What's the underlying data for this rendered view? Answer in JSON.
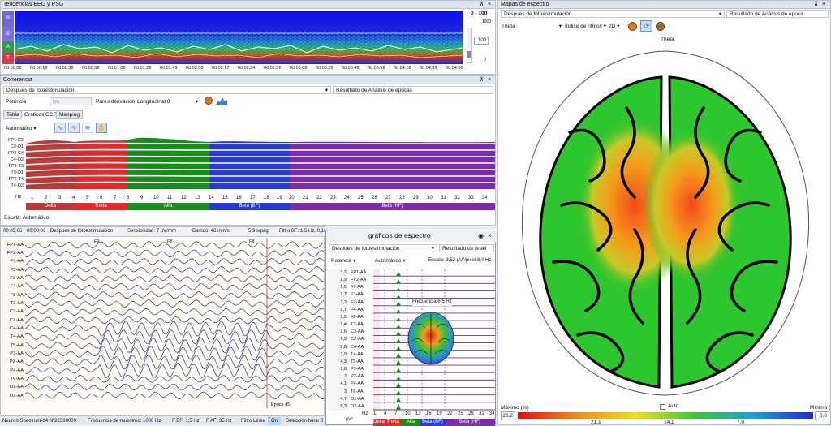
{
  "trends": {
    "title": "Tendencias EEG y PSG",
    "range": "0 - 100",
    "row_labels": [
      "B",
      "B",
      "A",
      "T"
    ],
    "scale_top": "1000",
    "scale_box": "100",
    "scale_bottom": "0",
    "times": [
      "00:00:01",
      "00:00:18",
      "00:00:35",
      "00:00:52",
      "00:01:09",
      "00:01:26",
      "00:01:43",
      "00:02:00",
      "00:02:17",
      "00:02:34",
      "00:02:51",
      "00:03:08",
      "00:03:25",
      "00:03:42",
      "00:03:59",
      "00:04:16",
      "00:04:33",
      "00:04:50"
    ]
  },
  "coherence": {
    "title": "Coherencia",
    "condition": "Despues de fotoestimulación",
    "result_label": "Resultado de Análisis de epocas",
    "mode_label": "Potencia",
    "mode_value": "No",
    "derivation_label": "Pares derivación:",
    "derivation_value": "Longitudinal 8",
    "tabs": [
      "Tabla",
      "Gráficos CCF",
      "Mapping"
    ],
    "auto": "Automático",
    "channels": [
      "FP1-C3",
      "C3-O1",
      "FP2-C4",
      "C4-O2",
      "FP1-T3",
      "T3-O1",
      "FP2-T4",
      "T4-O2"
    ],
    "hz_label": "Hz",
    "hz_ticks": [
      "1",
      "2",
      "3",
      "4",
      "5",
      "6",
      "7",
      "8",
      "9",
      "10",
      "11",
      "12",
      "13",
      "14",
      "15",
      "16",
      "17",
      "18",
      "19",
      "20",
      "21",
      "22",
      "23",
      "24",
      "25",
      "26",
      "27",
      "28",
      "29",
      "30",
      "31",
      "32",
      "33",
      "34"
    ],
    "bands": [
      "Delta",
      "Theta",
      "Alfa",
      "Beta (BF)",
      "Beta (HF)"
    ],
    "scale_note": "Escala: Automático"
  },
  "eeg": {
    "time_start": "00:05:06",
    "time_cursor": "00:00:06",
    "condition": "Despues de fotoestimulación",
    "sensitivity": "Sensibilidad: 7 µV/mm",
    "sweep": "Barrido: 48 mm/s",
    "sweep2": "5,9 s/pag",
    "hf": "Filtro BF: 1,5 Hz, 0,106",
    "marks": [
      "F9",
      "F8",
      "F8",
      "F8"
    ],
    "channels": [
      "FP1-AA",
      "FP2-AA",
      "F7-AA",
      "F3-AA",
      "FZ-AA",
      "F4-AA",
      "F8-AA",
      "T3-AA",
      "C3-AA",
      "CZ-AA",
      "C4-AA",
      "T4-AA",
      "T5-AA",
      "P3-AA",
      "PZ-AA",
      "P4-AA",
      "T6-AA",
      "O1-AA",
      "O2-AA"
    ],
    "epoch_label": "Epoca 45"
  },
  "spectrum_popup": {
    "title": "gráficos de espectro",
    "condition": "Despues de fotoestimulación",
    "result": "Resultado de Análi",
    "mode": "Potencia",
    "auto": "Automático",
    "scale": "Escala: 3,52 µV²/pixel 8,4 Hz",
    "values": [
      "3,2",
      "2,9",
      "1,5",
      "1,7",
      "3,3",
      "2,7",
      "1,5",
      "1,4",
      "2,6",
      "3,3",
      "2,8",
      "3,9",
      "4,3",
      "3,8",
      "2",
      "4,1",
      "3",
      "4,7",
      "5,3",
      "4,4"
    ],
    "channels": [
      "FP1-AA",
      "FP2-AA",
      "F7-AA",
      "F3-AA",
      "FZ-AA",
      "F4-AA",
      "F8-AA",
      "T3-AA",
      "C3-AA",
      "CZ-AA",
      "C4-AA",
      "T4-AA",
      "T5-AA",
      "P3-AA",
      "PZ-AA",
      "P4-AA",
      "T6-AA",
      "O1-AA",
      "O2-AA"
    ],
    "freq_label": "Frecuencia 6,5 Hz",
    "unit": "µV²",
    "hz": "Hz",
    "ticks": [
      "1",
      "4",
      "7",
      "10",
      "13",
      "16",
      "19",
      "22",
      "25",
      "28",
      "31",
      "34"
    ],
    "bands": [
      "Delta",
      "Theta",
      "Alfa",
      "Beta (BF)",
      "Beta (HF)"
    ]
  },
  "spectrum_map": {
    "title": "Mapas de espectro",
    "condition": "Despues de fotoestimulación",
    "result": "Resultado de Análisis de epoca",
    "rhythm": "Theta",
    "index": "Índice de ritmos",
    "view": "2D",
    "map_title": "Theta",
    "max_label": "Máximo (%)",
    "auto": "Auto",
    "min_label": "Mínimo (",
    "max_value": "28,2",
    "min_value": "0,0",
    "scale_ticks": [
      "21,1",
      "14,1",
      "7,0"
    ]
  },
  "status": {
    "device": "Neuron-Spectrum-64 Nº22360009",
    "sampling": "Frecuencia de muestreo: 1000 Hz",
    "fbf": "F BF: 1,5 Hz",
    "faf": "F AF: 35 Hz",
    "line": "Filtro Línea",
    "on": "On",
    "selection": "Selección hora: 0"
  },
  "colors": {
    "delta": "#b8393a",
    "theta": "#e32b2b",
    "alfa": "#1c8a1f",
    "beta_bf": "#2539d4",
    "beta_hf": "#7b2ea8"
  }
}
